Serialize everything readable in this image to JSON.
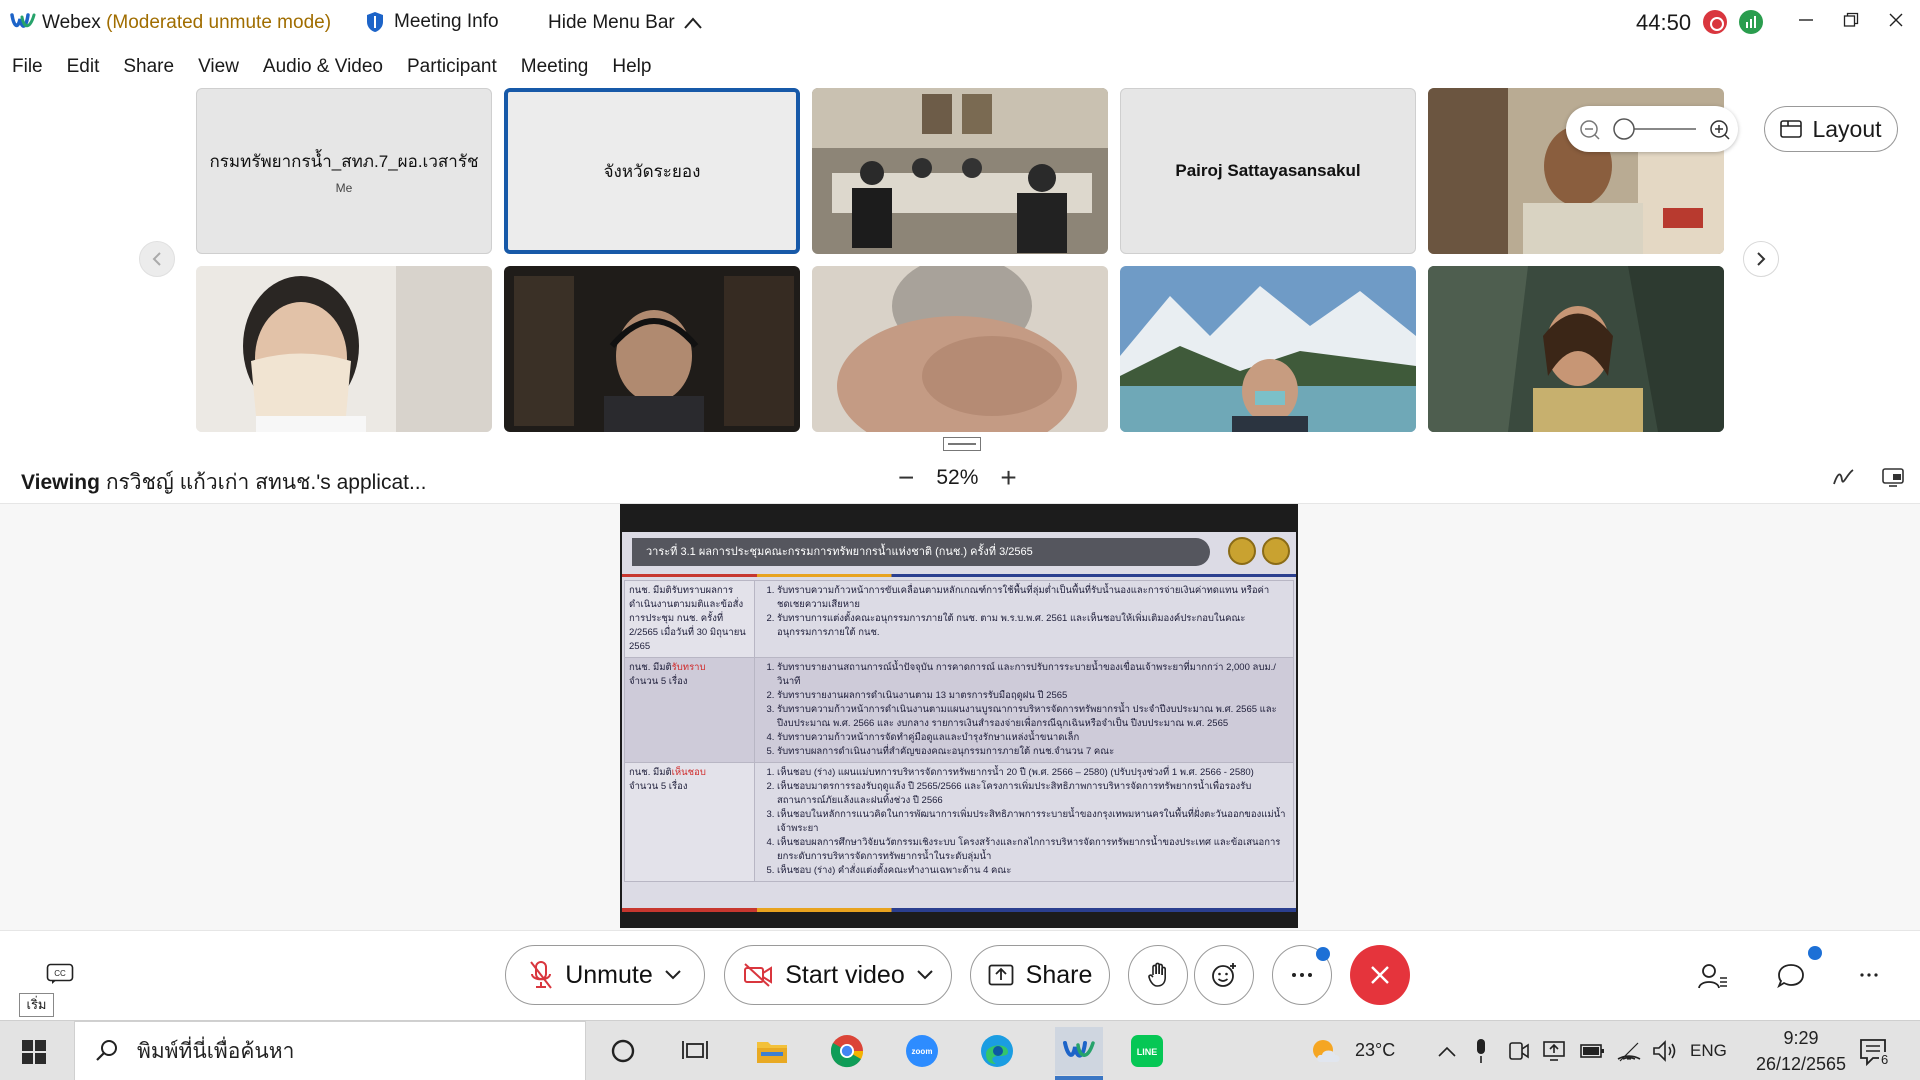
{
  "window": {
    "app_name": "Webex",
    "mode": "(Moderated unmute mode)",
    "meeting_info": "Meeting Info",
    "hide_menu": "Hide Menu Bar",
    "timer": "44:50"
  },
  "menu": [
    "File",
    "Edit",
    "Share",
    "View",
    "Audio & Video",
    "Participant",
    "Meeting",
    "Help"
  ],
  "participants": {
    "p1": {
      "name": "กรมทรัพยากรน้ำ_สทภ.7_ผอ.เวสารัช",
      "sub": "Me"
    },
    "p2": {
      "name": "จังหวัดระยอง"
    },
    "p4": {
      "name": "Pairoj Sattayasansakul"
    }
  },
  "layout_label": "Layout",
  "viewing": {
    "prefix": "Viewing",
    "name": "กรวิชญ์ แก้วเก่า สทนช.'s applicat...",
    "zoom": "52%"
  },
  "slide": {
    "title": "วาระที่ 3.1 ผลการประชุมคณะกรรมการทรัพยากรน้ำแห่งชาติ (กนช.) ครั้งที่ 3/2565",
    "row1_left": "กนช. มีมติรับทราบผลการดำเนินงานตามมติและข้อสั่งการประชุม กนช. ครั้งที่ 2/2565 เมื่อวันที่ 30 มิถุนายน 2565",
    "row1_items": [
      "รับทราบความก้าวหน้าการขับเคลื่อนตามหลักเกณฑ์การใช้พื้นที่ลุ่มต่ำเป็นพื้นที่รับน้ำนองและการจ่ายเงินค่าทดแทน หรือค่าชดเชยความเสียหาย",
      "รับทราบการแต่งตั้งคณะอนุกรรมการภายใต้ กนช. ตาม พ.ร.บ.พ.ศ. 2561 และเห็นชอบให้เพิ่มเติมองค์ประกอบในคณะอนุกรรมการภายใต้ กนช."
    ],
    "row2_left_a": "กนช. มีมติ",
    "row2_left_b": "รับทราบ",
    "row2_left_c": "จำนวน 5 เรื่อง",
    "row2_items": [
      "รับทราบรายงานสถานการณ์น้ำปัจจุบัน การคาดการณ์ และการปรับการระบายน้ำของเขื่อนเจ้าพระยาที่มากกว่า 2,000 ลบม./วินาที",
      "รับทราบรายงานผลการดำเนินงานตาม 13 มาตรการรับมือฤดูฝน ปี 2565",
      "รับทราบความก้าวหน้าการดำเนินงานตามแผนงานบูรณาการบริหารจัดการทรัพยากรน้ำ ประจำปีงบประมาณ พ.ศ. 2565 และปีงบประมาณ พ.ศ. 2566 และ งบกลาง รายการเงินสำรองจ่ายเพื่อกรณีฉุกเฉินหรือจำเป็น ปีงบประมาณ พ.ศ. 2565",
      "รับทราบความก้าวหน้าการจัดทำคู่มือดูแลและบำรุงรักษาแหล่งน้ำขนาดเล็ก",
      "รับทราบผลการดำเนินงานที่สำคัญของคณะอนุกรรมการภายใต้ กนช.จำนวน 7 คณะ"
    ],
    "row3_left_a": "กนช. มีมติ",
    "row3_left_b": "เห็นชอบ",
    "row3_left_c": "จำนวน 5 เรื่อง",
    "row3_items": [
      "เห็นชอบ (ร่าง) แผนแม่บทการบริหารจัดการทรัพยากรน้ำ 20 ปี (พ.ศ. 2566 – 2580) (ปรับปรุงช่วงที่ 1 พ.ศ. 2566 - 2580)",
      "เห็นชอบมาตรการรองรับฤดูแล้ง ปี 2565/2566 และโครงการเพิ่มประสิทธิภาพการบริหารจัดการทรัพยากรน้ำเพื่อรองรับสถานการณ์ภัยแล้งและฝนทิ้งช่วง ปี 2566",
      "เห็นชอบในหลักการแนวคิดในการพัฒนาการเพิ่มประสิทธิภาพการระบายน้ำของกรุงเทพมหานครในพื้นที่ฝั่งตะวันออกของแม่น้ำเจ้าพระยา",
      "เห็นชอบผลการศึกษาวิจัยนวัตกรรมเชิงระบบ โครงสร้างและกลไกการบริหารจัดการทรัพยากรน้ำของประเทศ และข้อเสนอการยกระดับการบริหารจัดการทรัพยากรน้ำในระดับลุ่มน้ำ",
      "เห็นชอบ (ร่าง) คำสั่งแต่งตั้งคณะทำงานเฉพาะด้าน 4 คณะ"
    ]
  },
  "controls": {
    "unmute": "Unmute",
    "start_video": "Start video",
    "share": "Share",
    "start_label": "เริ่ม"
  },
  "taskbar": {
    "search_placeholder": "พิมพ์ที่นี่เพื่อค้นหา",
    "temperature": "23°C",
    "language": "ENG",
    "time": "9:29",
    "date": "26/12/2565",
    "notifications": "6"
  },
  "colors": {
    "accent": "#1759a8",
    "end_call": "#e5343c",
    "recording": "#d9363e",
    "network": "#2a9d4e",
    "mode_text": "#a06d00"
  }
}
